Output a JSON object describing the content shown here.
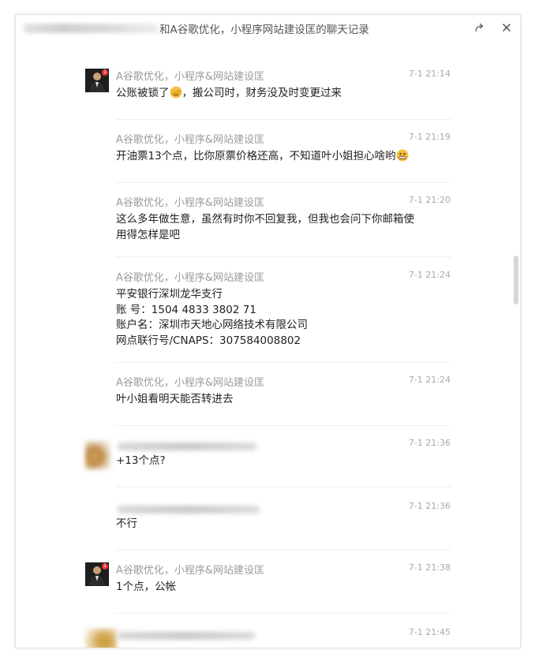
{
  "window": {
    "title": "和A谷歌优化，小程序网站建设匡的聊天记录",
    "share_icon": "share-icon",
    "close_icon": "close-icon"
  },
  "messages": [
    {
      "sender": "A谷歌优化，小程序&网站建设匡",
      "time": "7-1 21:14",
      "lines": [
        "公账被锁了",
        "，搬公司时，财务没及时变更过来"
      ],
      "emoji": "facepalm-emoji"
    },
    {
      "sender": "A谷歌优化，小程序&网站建设匡",
      "time": "7-1 21:19",
      "lines": [
        "开油票13个点，比你原票价格还高，不知道叶小姐担心啥哟"
      ],
      "emoji": "grin-emoji"
    },
    {
      "sender": "A谷歌优化，小程序&网站建设匡",
      "time": "7-1 21:20",
      "lines": [
        "这么多年做生意，虽然有时你不回复我，但我也会问下你邮箱使",
        "用得怎样是吧"
      ]
    },
    {
      "sender": "A谷歌优化，小程序&网站建设匡",
      "time": "7-1 21:24",
      "lines": [
        "平安银行深圳龙华支行",
        "账 号：1504 4833 3802 71",
        "账户名：深圳市天地心网络技术有限公司",
        "网点联行号/CNAPS：307584008802"
      ]
    },
    {
      "sender": "A谷歌优化，小程序&网站建设匡",
      "time": "7-1 21:24",
      "lines": [
        "叶小姐看明天能否转进去"
      ]
    },
    {
      "sender": "",
      "time": "7-1 21:36",
      "lines": [
        "+13个点?"
      ]
    },
    {
      "sender": "",
      "time": "7-1 21:36",
      "lines": [
        "不行"
      ]
    },
    {
      "sender": "A谷歌优化，小程序&网站建设匡",
      "time": "7-1 21:38",
      "lines": [
        "1个点，公帐"
      ]
    },
    {
      "sender": "",
      "time": "7-1 21:45",
      "lines": []
    }
  ]
}
